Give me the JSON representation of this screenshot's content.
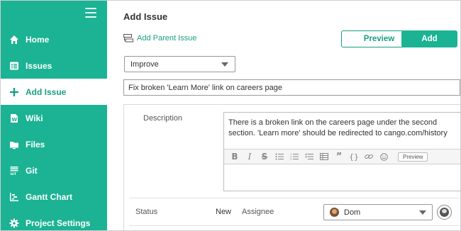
{
  "sidebar": {
    "items": [
      {
        "label": "Home",
        "icon": "home-icon"
      },
      {
        "label": "Issues",
        "icon": "issues-list-icon"
      },
      {
        "label": "Add Issue",
        "icon": "plus-icon"
      },
      {
        "label": "Wiki",
        "icon": "wiki-icon"
      },
      {
        "label": "Files",
        "icon": "folder-icon"
      },
      {
        "label": "Git",
        "icon": "git-icon"
      },
      {
        "label": "Gantt Chart",
        "icon": "gantt-icon"
      },
      {
        "label": "Project Settings",
        "icon": "gear-icon"
      }
    ],
    "accent": "#1bb394"
  },
  "main": {
    "title": "Add Issue",
    "add_parent_label": "Add Parent Issue",
    "preview_label": "Preview",
    "add_label": "Add",
    "issue_type": "Improve",
    "issue_title": "Fix broken 'Learn More' link on careers page",
    "description_label": "Description",
    "description_text": "There is a broken link on the careers page under the second section. 'Learn more' should be redirected to cango.com/history",
    "toolbar_preview_label": "Preview",
    "status_label": "Status",
    "status_value": "New",
    "assignee_label": "Assignee",
    "assignee_value": "Dom"
  }
}
